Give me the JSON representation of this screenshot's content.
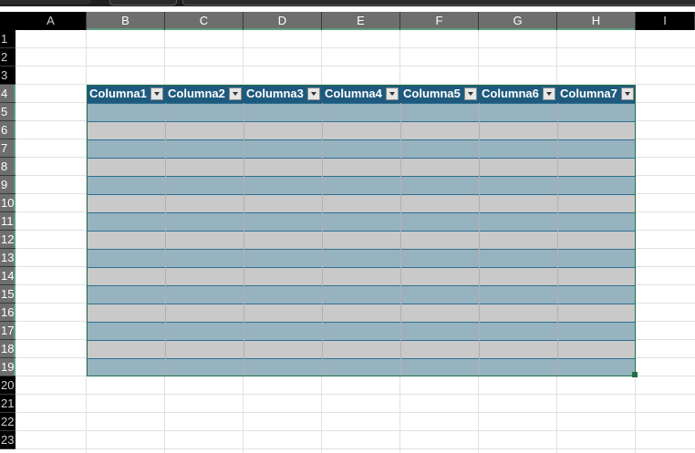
{
  "columns": [
    "A",
    "B",
    "C",
    "D",
    "E",
    "F",
    "G",
    "H",
    "I"
  ],
  "rows": [
    "1",
    "2",
    "3",
    "4",
    "5",
    "6",
    "7",
    "8",
    "9",
    "10",
    "11",
    "12",
    "13",
    "14",
    "15",
    "16",
    "17",
    "18",
    "19",
    "20",
    "21",
    "22",
    "23"
  ],
  "table": {
    "headers": [
      "Columna1",
      "Columna2",
      "Columna3",
      "Columna4",
      "Columna5",
      "Columna6",
      "Columna7"
    ],
    "header_color": "#1e5a7e",
    "band_dark": "#97b3c0",
    "band_light": "#c9c9c9"
  }
}
